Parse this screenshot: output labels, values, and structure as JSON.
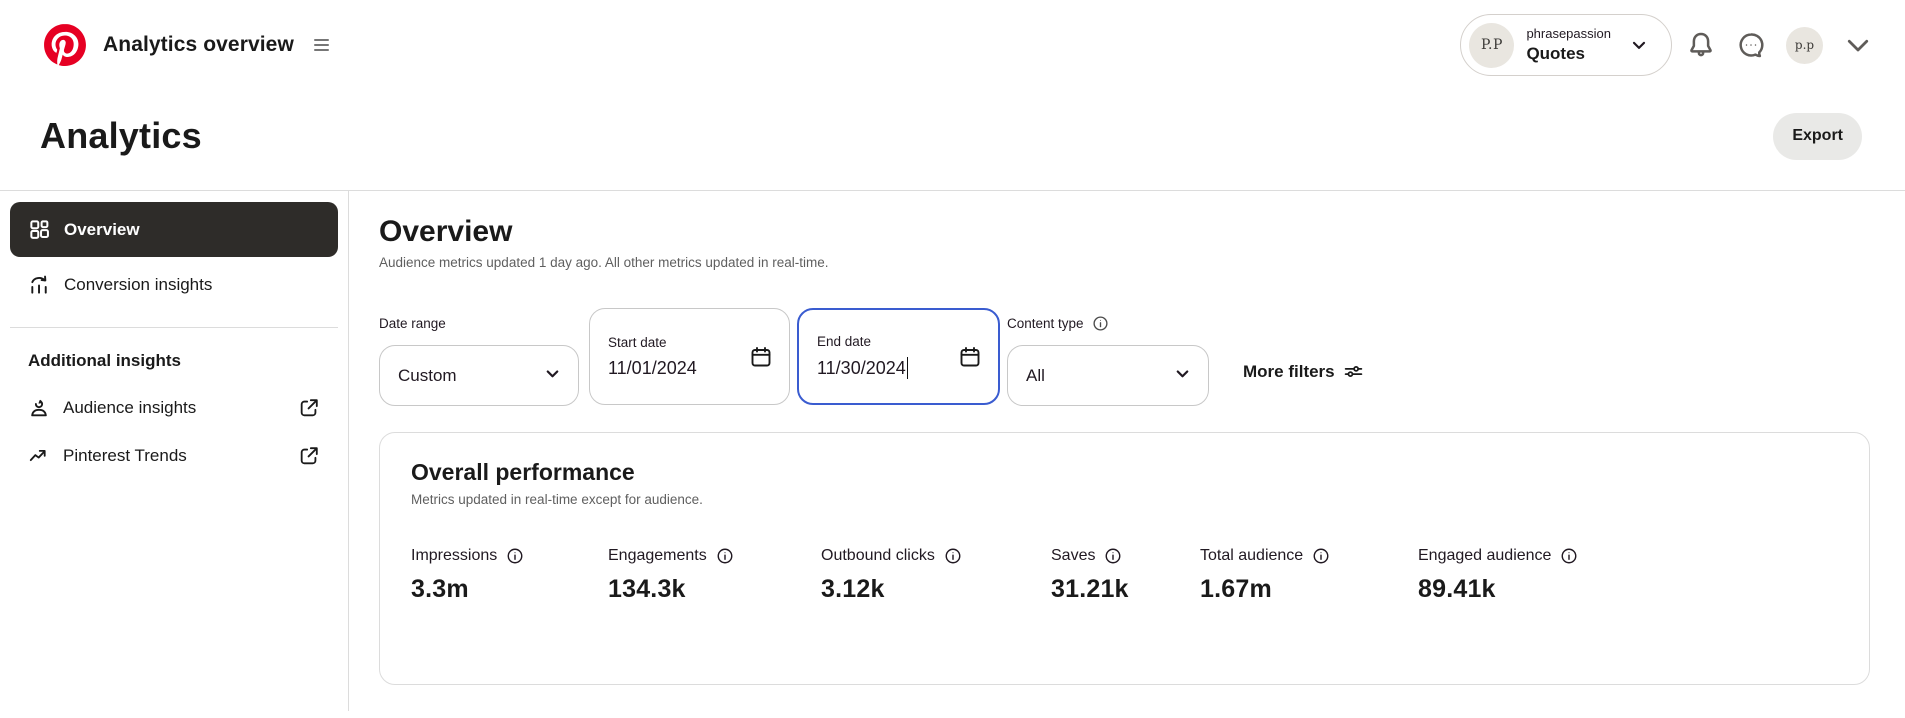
{
  "topbar": {
    "app_title": "Analytics overview",
    "account": {
      "avatar_initials": "P.P",
      "username": "phrasepassion",
      "board": "Quotes"
    },
    "user_avatar_initials": "p.p"
  },
  "page": {
    "title": "Analytics",
    "export_label": "Export"
  },
  "sidebar": {
    "items": [
      {
        "label": "Overview"
      },
      {
        "label": "Conversion insights"
      }
    ],
    "section_title": "Additional insights",
    "links": [
      {
        "label": "Audience insights"
      },
      {
        "label": "Pinterest Trends"
      }
    ]
  },
  "main": {
    "title": "Overview",
    "subtitle": "Audience metrics updated 1 day ago. All other metrics updated in real-time.",
    "filters": {
      "date_range_label": "Date range",
      "date_range_value": "Custom",
      "start_date": {
        "label": "Start date",
        "value": "11/01/2024"
      },
      "end_date": {
        "label": "End date",
        "value": "11/30/2024"
      },
      "content_type_label": "Content type",
      "content_type_value": "All",
      "more_filters_label": "More filters"
    },
    "card": {
      "title": "Overall performance",
      "subtitle": "Metrics updated in real-time except for audience.",
      "metrics": [
        {
          "label": "Impressions",
          "value": "3.3m"
        },
        {
          "label": "Engagements",
          "value": "134.3k"
        },
        {
          "label": "Outbound clicks",
          "value": "3.12k"
        },
        {
          "label": "Saves",
          "value": "31.21k"
        },
        {
          "label": "Total audience",
          "value": "1.67m"
        },
        {
          "label": "Engaged audience",
          "value": "89.41k"
        }
      ]
    }
  },
  "colors": {
    "brand_red": "#E60023",
    "focus_blue": "#3a5cd0",
    "selected_nav_bg": "#2e2c29",
    "export_bg": "#e9e9e7"
  }
}
